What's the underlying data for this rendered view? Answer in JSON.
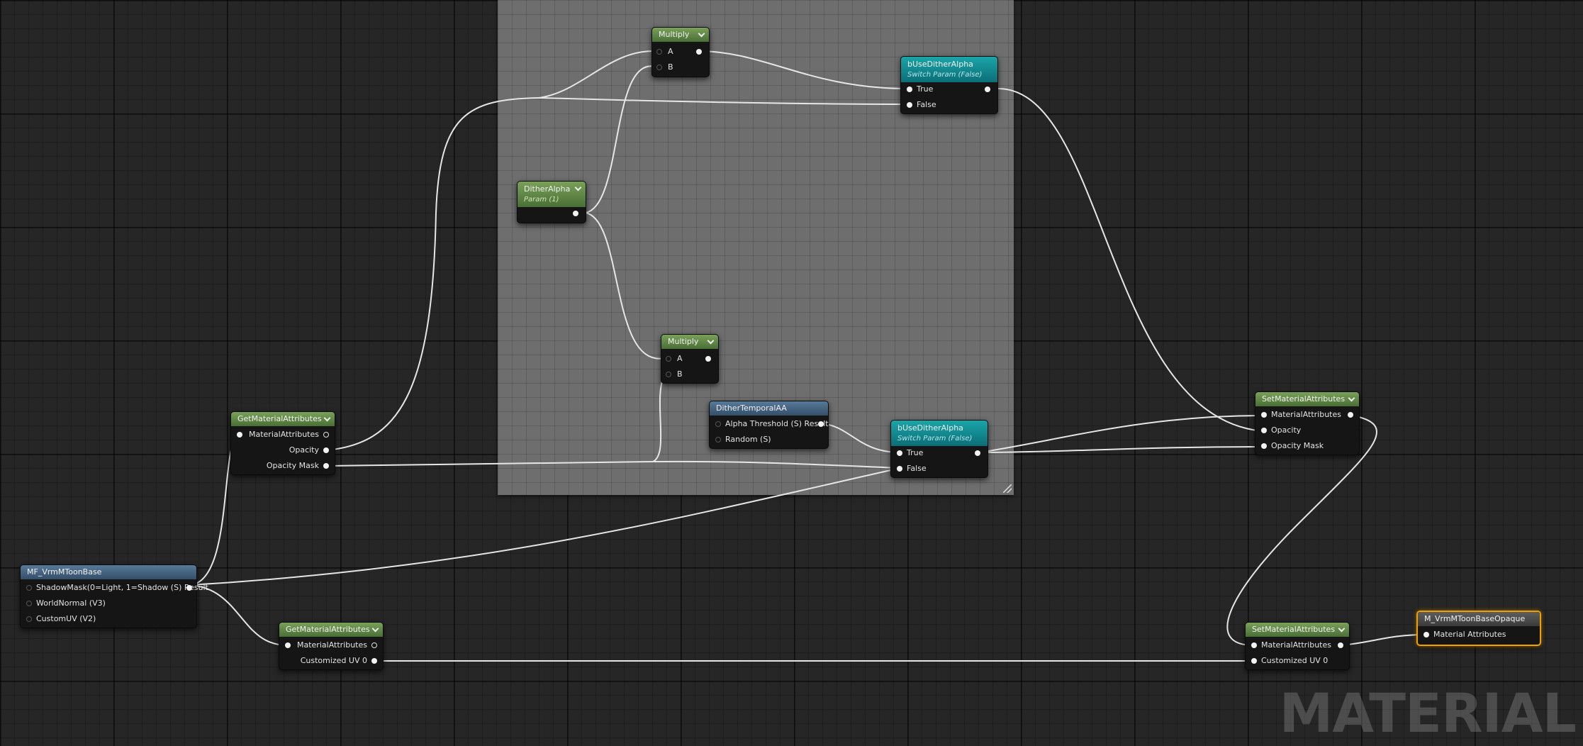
{
  "watermark": "MATERIAL",
  "nodes": {
    "multiply_top": {
      "title": "Multiply",
      "pins": {
        "a": "A",
        "b": "B"
      }
    },
    "use_dither_alpha_top": {
      "title": "bUseDitherAlpha",
      "subtitle": "Switch Param (False)",
      "pins": {
        "true": "True",
        "false": "False"
      }
    },
    "dither_alpha": {
      "title": "DitherAlpha",
      "subtitle": "Param (1)"
    },
    "multiply_mid": {
      "title": "Multiply",
      "pins": {
        "a": "A",
        "b": "B"
      }
    },
    "dither_temporal_aa": {
      "title": "DitherTemporalAA",
      "pins": {
        "alpha_threshold": "Alpha Threshold (S) Result",
        "random": "Random (S)"
      }
    },
    "use_dither_alpha_bottom": {
      "title": "bUseDitherAlpha",
      "subtitle": "Switch Param (False)",
      "pins": {
        "true": "True",
        "false": "False"
      }
    },
    "get_material_attributes_1": {
      "title": "GetMaterialAttributes",
      "pins": {
        "material_attributes": "MaterialAttributes",
        "opacity": "Opacity",
        "opacity_mask": "Opacity Mask"
      }
    },
    "mf_vrm_mtoon_base": {
      "title": "MF_VrmMToonBase",
      "pins": {
        "shadow_mask": "ShadowMask(0=Light, 1=Shadow (S) Result",
        "world_normal": "WorldNormal (V3)",
        "custom_uv": "CustomUV (V2)"
      }
    },
    "get_material_attributes_2": {
      "title": "GetMaterialAttributes",
      "pins": {
        "material_attributes": "MaterialAttributes",
        "customized_uv0": "Customized UV 0"
      }
    },
    "set_material_attributes_1": {
      "title": "SetMaterialAttributes",
      "pins": {
        "material_attributes": "MaterialAttributes",
        "opacity": "Opacity",
        "opacity_mask": "Opacity Mask"
      }
    },
    "set_material_attributes_2": {
      "title": "SetMaterialAttributes",
      "pins": {
        "material_attributes": "MaterialAttributes",
        "customized_uv0": "Customized UV 0"
      }
    },
    "output": {
      "title": "M_VrmMToonBaseOpaque",
      "pins": {
        "material_attributes": "Material Attributes"
      }
    }
  },
  "colors": {
    "graph_background": "#262626",
    "comment_box": "#6e6e6e",
    "wire": "#e6e6e6",
    "param_header": "#5a8040",
    "switch_header": "#1aa5a8",
    "function_header": "#466484",
    "selected_border": "#f0a000"
  }
}
